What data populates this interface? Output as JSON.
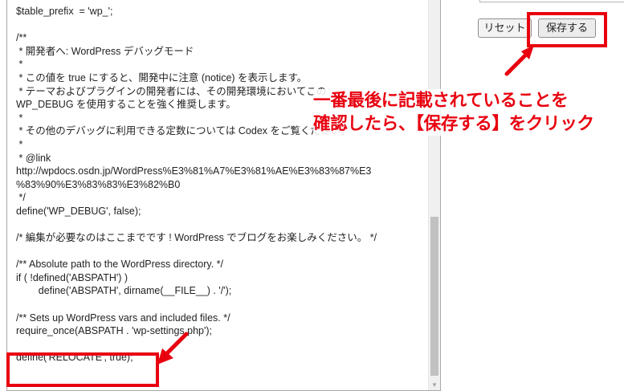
{
  "editor": {
    "lines": [
      "$table_prefix  = 'wp_';",
      "",
      "/**",
      " * 開発者へ: WordPress デバッグモード",
      " *",
      " * この値を true にすると、開発中に注意 (notice) を表示します。",
      " * テーマおよびプラグインの開発者には、その開発環境においてこの",
      "WP_DEBUG を使用することを強く推奨します。",
      " *",
      " * その他のデバッグに利用できる定数については Codex をご覧ください。",
      " *",
      " * @link",
      "http://wpdocs.osdn.jp/WordPress%E3%81%A7%E3%81%AE%E3%83%87%E3",
      "%83%90%E3%83%83%E3%82%B0",
      " */",
      "define('WP_DEBUG', false);",
      "",
      "/* 編集が必要なのはここまでです ! WordPress でブログをお楽しみください。 */",
      "",
      "/** Absolute path to the WordPress directory. */",
      "if ( !defined('ABSPATH') )",
      "\tdefine('ABSPATH', dirname(__FILE__) . '/');",
      "",
      "/** Sets up WordPress vars and included files. */",
      "require_once(ABSPATH . 'wp-settings.php');",
      "",
      "define('RELOCATE', true);"
    ]
  },
  "buttons": {
    "reset_label": "リセット",
    "save_label": "保存する"
  },
  "annotation": {
    "callout_line1": "一番最後に記載されていることを",
    "callout_line2": "確認したら、【保存する】をクリック",
    "color": "#e8000f"
  }
}
